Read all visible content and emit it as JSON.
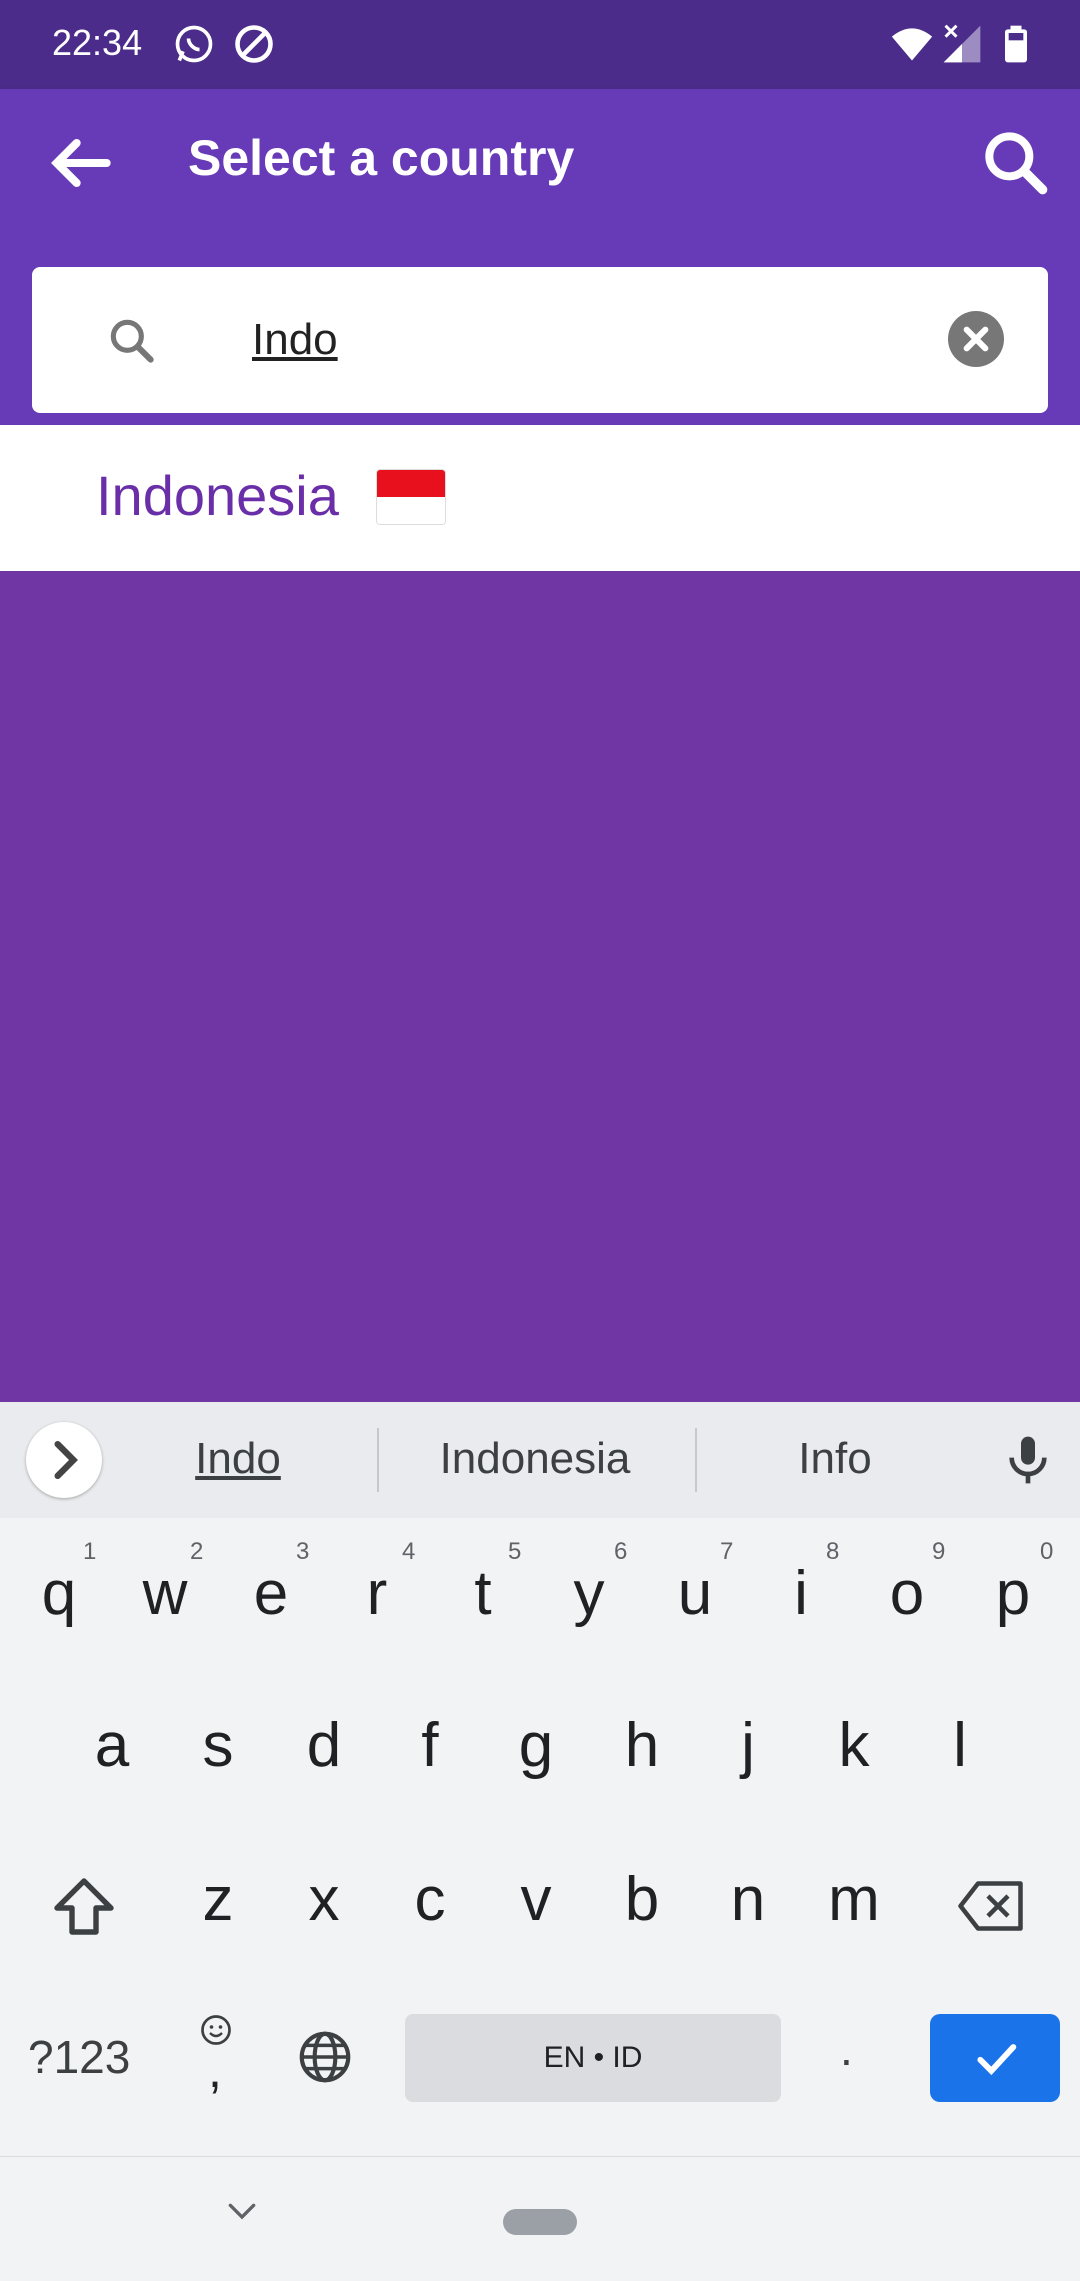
{
  "status": {
    "time": "22:34"
  },
  "app_bar": {
    "title": "Select a country"
  },
  "search": {
    "value": "Indo"
  },
  "results": [
    {
      "name": "Indonesia"
    }
  ],
  "keyboard": {
    "suggestions": [
      "Indo",
      "Indonesia",
      "Info"
    ],
    "row1": [
      {
        "k": "q",
        "h": "1"
      },
      {
        "k": "w",
        "h": "2"
      },
      {
        "k": "e",
        "h": "3"
      },
      {
        "k": "r",
        "h": "4"
      },
      {
        "k": "t",
        "h": "5"
      },
      {
        "k": "y",
        "h": "6"
      },
      {
        "k": "u",
        "h": "7"
      },
      {
        "k": "i",
        "h": "8"
      },
      {
        "k": "o",
        "h": "9"
      },
      {
        "k": "p",
        "h": "0"
      }
    ],
    "row2": [
      "a",
      "s",
      "d",
      "f",
      "g",
      "h",
      "j",
      "k",
      "l"
    ],
    "row3": [
      "z",
      "x",
      "c",
      "v",
      "b",
      "n",
      "m"
    ],
    "symbols_label": "?123",
    "space_label": "EN • ID",
    "comma_label": ",",
    "period_label": "."
  },
  "colors": {
    "primary": "#673ab7",
    "status": "#4b2c8a",
    "accent": "#6a2fa8",
    "enter": "#1a73e8"
  },
  "icons": [
    "back-arrow-icon",
    "search-icon",
    "clear-icon",
    "whatsapp-icon",
    "no-disturb-icon",
    "wifi-icon",
    "signal-icon",
    "battery-icon",
    "mic-icon",
    "shift-icon",
    "backspace-icon",
    "globe-icon",
    "emoji-icon",
    "check-icon",
    "chevron-down-icon",
    "chevron-right-icon"
  ]
}
